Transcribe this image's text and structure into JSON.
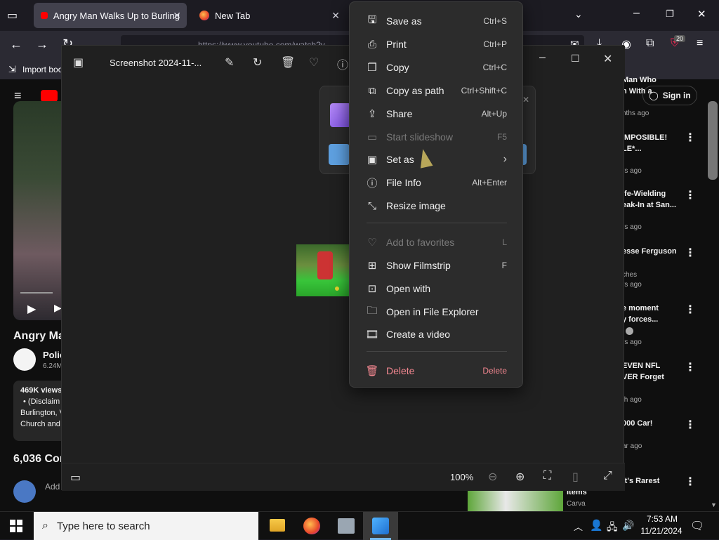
{
  "browser": {
    "tabs": [
      {
        "label": "Angry Man Walks Up to Burling",
        "active": true
      },
      {
        "label": "New Tab",
        "active": false
      }
    ],
    "url": "https://www.youtube.com/watch?v",
    "bookmarks_label": "Import boo",
    "notification_count": "20"
  },
  "youtube": {
    "title_fragment": "Angry Ma",
    "channel_fragment": "Polic",
    "subscribers_fragment": "6.24M",
    "views_fragment": "469K views",
    "desc_lines": [
      "• (Disclaim",
      "Burlington, V",
      "Church and"
    ],
    "comments_count": "6,036 Con",
    "add_comment": "Add",
    "sign_in": "Sign in",
    "recommendations": [
      {
        "title1": "Man Who",
        "title2": "n With a",
        "meta": "nths ago"
      },
      {
        "title1": "IMPOSIBLE!",
        "title2": "LE*...",
        "meta": "rs ago"
      },
      {
        "title1": "ife-Wielding",
        "title2": "eak-In at San...",
        "meta": "rs ago"
      },
      {
        "title1": "esse Ferguson",
        "title2": "",
        "meta1": "ches",
        "meta": "rs ago"
      },
      {
        "title1": "e moment",
        "title2": "y forces...",
        "meta": "rs ago"
      },
      {
        "title1": "EVEN NFL",
        "title2": "VER Forget",
        "meta": "th ago"
      },
      {
        "title1": "000 Car!",
        "title2": "",
        "meta": "ar ago"
      },
      {
        "title1": "ft's Rarest",
        "title2": "Items",
        "meta": "Carva"
      }
    ]
  },
  "photos": {
    "file_title": "Screenshot 2024-11-...",
    "zoom": "100%"
  },
  "context_menu": {
    "items": [
      {
        "label": "Save as",
        "shortcut": "Ctrl+S",
        "icon": "save-as-icon",
        "glyph": "🖫"
      },
      {
        "label": "Print",
        "shortcut": "Ctrl+P",
        "icon": "print-icon",
        "glyph": "⎙"
      },
      {
        "label": "Copy",
        "shortcut": "Ctrl+C",
        "icon": "copy-icon",
        "glyph": "❐"
      },
      {
        "label": "Copy as path",
        "shortcut": "Ctrl+Shift+C",
        "icon": "copy-path-icon",
        "glyph": "⧉"
      },
      {
        "label": "Share",
        "shortcut": "Alt+Up",
        "icon": "share-icon",
        "glyph": "⇪"
      },
      {
        "label": "Start slideshow",
        "shortcut": "F5",
        "icon": "slideshow-icon",
        "glyph": "▭",
        "disabled": true
      },
      {
        "label": "Set as",
        "shortcut": "›",
        "icon": "set-as-icon",
        "glyph": "▣"
      },
      {
        "label": "File Info",
        "shortcut": "Alt+Enter",
        "icon": "info-icon",
        "glyph": "ⓘ"
      },
      {
        "label": "Resize image",
        "shortcut": "",
        "icon": "resize-icon",
        "glyph": "⤡"
      },
      {
        "label": "Add to favorites",
        "shortcut": "L",
        "icon": "heart-icon",
        "glyph": "♡",
        "disabled": true
      },
      {
        "label": "Show Filmstrip",
        "shortcut": "F",
        "icon": "filmstrip-icon",
        "glyph": "⊞"
      },
      {
        "label": "Open with",
        "shortcut": "",
        "icon": "open-with-icon",
        "glyph": "⊡"
      },
      {
        "label": "Open in File Explorer",
        "shortcut": "",
        "icon": "folder-icon",
        "glyph": "🗀"
      },
      {
        "label": "Create a video",
        "shortcut": "",
        "icon": "video-icon",
        "glyph": "🎞"
      },
      {
        "label": "Delete",
        "shortcut": "Delete",
        "icon": "delete-icon",
        "glyph": "🗑",
        "danger": true
      }
    ]
  },
  "taskbar": {
    "search_placeholder": "Type here to search",
    "time": "7:53 AM",
    "date": "11/21/2024"
  },
  "colors": {
    "accent": "#0078d4",
    "danger": "#f1868f",
    "youtube_red": "#ff0000"
  }
}
